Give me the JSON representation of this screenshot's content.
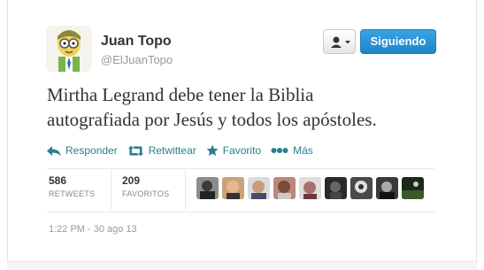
{
  "user": {
    "name": "Juan Topo",
    "handle": "@ElJuanTopo"
  },
  "buttons": {
    "follow_label": "Siguiendo"
  },
  "tweet": {
    "text_line1": "Mirtha Legrand debe tener la Biblia",
    "text_line2": "autografiada por Jesús y todos los apóstoles."
  },
  "actions": {
    "reply": "Responder",
    "retweet": "Retwittear",
    "favorite": "Favorito",
    "more": "Más"
  },
  "stats": {
    "retweets_count": "586",
    "retweets_label": "RETWEETS",
    "favorites_count": "209",
    "favorites_label": "FAVORITOS"
  },
  "timestamp": "1:22 PM - 30 ago 13",
  "colors": {
    "action": "#2a7e8f",
    "follow_button": "#2b8fd6"
  },
  "icons": {
    "reply": "reply-arrow-icon",
    "retweet": "retweet-icon",
    "favorite": "star-icon",
    "more": "more-dots-icon",
    "user_menu": "user-dropdown-icon"
  }
}
